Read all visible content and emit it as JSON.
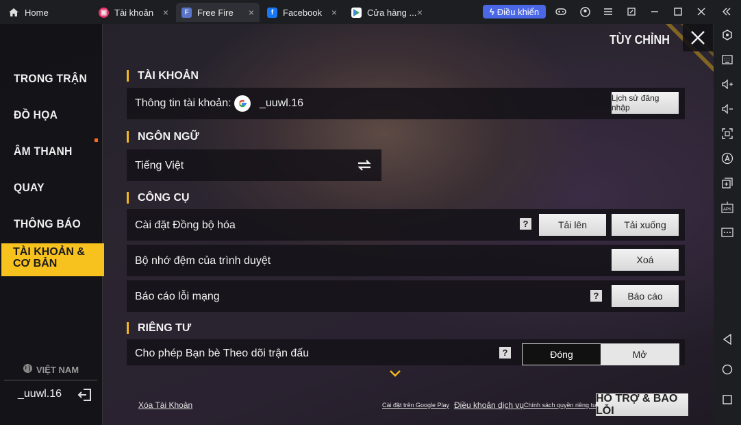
{
  "tabs": [
    {
      "label": "Home",
      "icon": "home-icon"
    },
    {
      "label": "Tài khoản",
      "icon": "account-app-icon"
    },
    {
      "label": "Free Fire",
      "icon": "free-fire-icon"
    },
    {
      "label": "Facebook",
      "icon": "facebook-icon"
    },
    {
      "label": "Cửa hàng ...",
      "icon": "play-store-icon"
    }
  ],
  "titlebar": {
    "control_label": "Điều khiển",
    "close_glyph": "×"
  },
  "header": {
    "title": "TÙY CHỈNH"
  },
  "nav": {
    "items": [
      "TRONG TRẬN",
      "ĐỒ HỌA",
      "ÂM THANH",
      "QUAY",
      "THÔNG BÁO"
    ],
    "active": "TÀI KHOẢN & CƠ BẢN",
    "region": "VIỆT NAM",
    "username": "_uuwl.16"
  },
  "account": {
    "section": "TÀI KHOẢN",
    "info_label": "Thông tin tài khoản:",
    "username": "_uuwl.16",
    "history_button": "Lịch sử đăng nhập"
  },
  "language": {
    "section": "NGÔN NGỮ",
    "value": "Tiếng Việt"
  },
  "tools": {
    "section": "CÔNG CỤ",
    "sync_label": "Cài đặt Đồng bộ hóa",
    "upload": "Tải lên",
    "download": "Tải xuống",
    "cache_label": "Bộ nhớ đệm của trình duyệt",
    "clear": "Xoá",
    "report_label": "Báo cáo lỗi mạng",
    "report": "Báo cáo",
    "help": "?"
  },
  "privacy": {
    "section": "RIÊNG TƯ",
    "follow_label": "Cho phép Bạn bè Theo dõi trận đấu",
    "off": "Đóng",
    "on": "Mở",
    "selected": "Đóng"
  },
  "footer": {
    "delete_account": "Xóa Tài Khoản",
    "google_play": "Cài đặt trên Google Play",
    "terms": "Điều khoản dịch vụ",
    "privacy_policy": "Chính sách quyền riêng tư",
    "support": "HỖ TRỢ & BÁO LỖI"
  },
  "colors": {
    "accent": "#f7c21e",
    "control_button": "#4a67e6"
  }
}
